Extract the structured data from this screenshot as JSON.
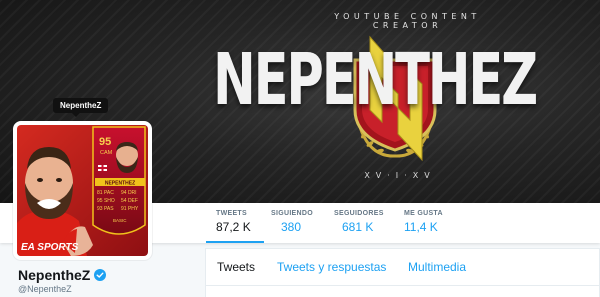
{
  "banner": {
    "tagline": "YOUTUBE CONTENT CREATOR",
    "title": "NEPENTHEZ",
    "date": "XV·I·XV"
  },
  "avatar_card": {
    "rating": "95",
    "position": "CAM",
    "card_name": "NEPENTHEZ",
    "stats_left": [
      "81 PAC",
      "95 SHO",
      "93 PAS"
    ],
    "stats_right": [
      "94 DRI",
      "54 DEF",
      "91 PHY"
    ],
    "chemistry": "BASIC",
    "brand": "EA SPORTS"
  },
  "tooltip": "NepentheZ",
  "profile": {
    "name": "NepentheZ",
    "handle": "@NepentheZ",
    "verified": true
  },
  "stats": [
    {
      "label": "TWEETS",
      "value": "87,2 K",
      "active": true
    },
    {
      "label": "SIGUIENDO",
      "value": "380",
      "active": false
    },
    {
      "label": "SEGUIDORES",
      "value": "681 K",
      "active": false
    },
    {
      "label": "ME GUSTA",
      "value": "11,4 K",
      "active": false
    }
  ],
  "tabs": [
    {
      "label": "Tweets",
      "active": true
    },
    {
      "label": "Tweets y respuestas",
      "active": false
    },
    {
      "label": "Multimedia",
      "active": false
    }
  ],
  "colors": {
    "accent": "#1da1f2",
    "text": "#14171a",
    "muted": "#657786",
    "card_red": "#c8102e",
    "emblem_gold": "#d9c23a"
  }
}
